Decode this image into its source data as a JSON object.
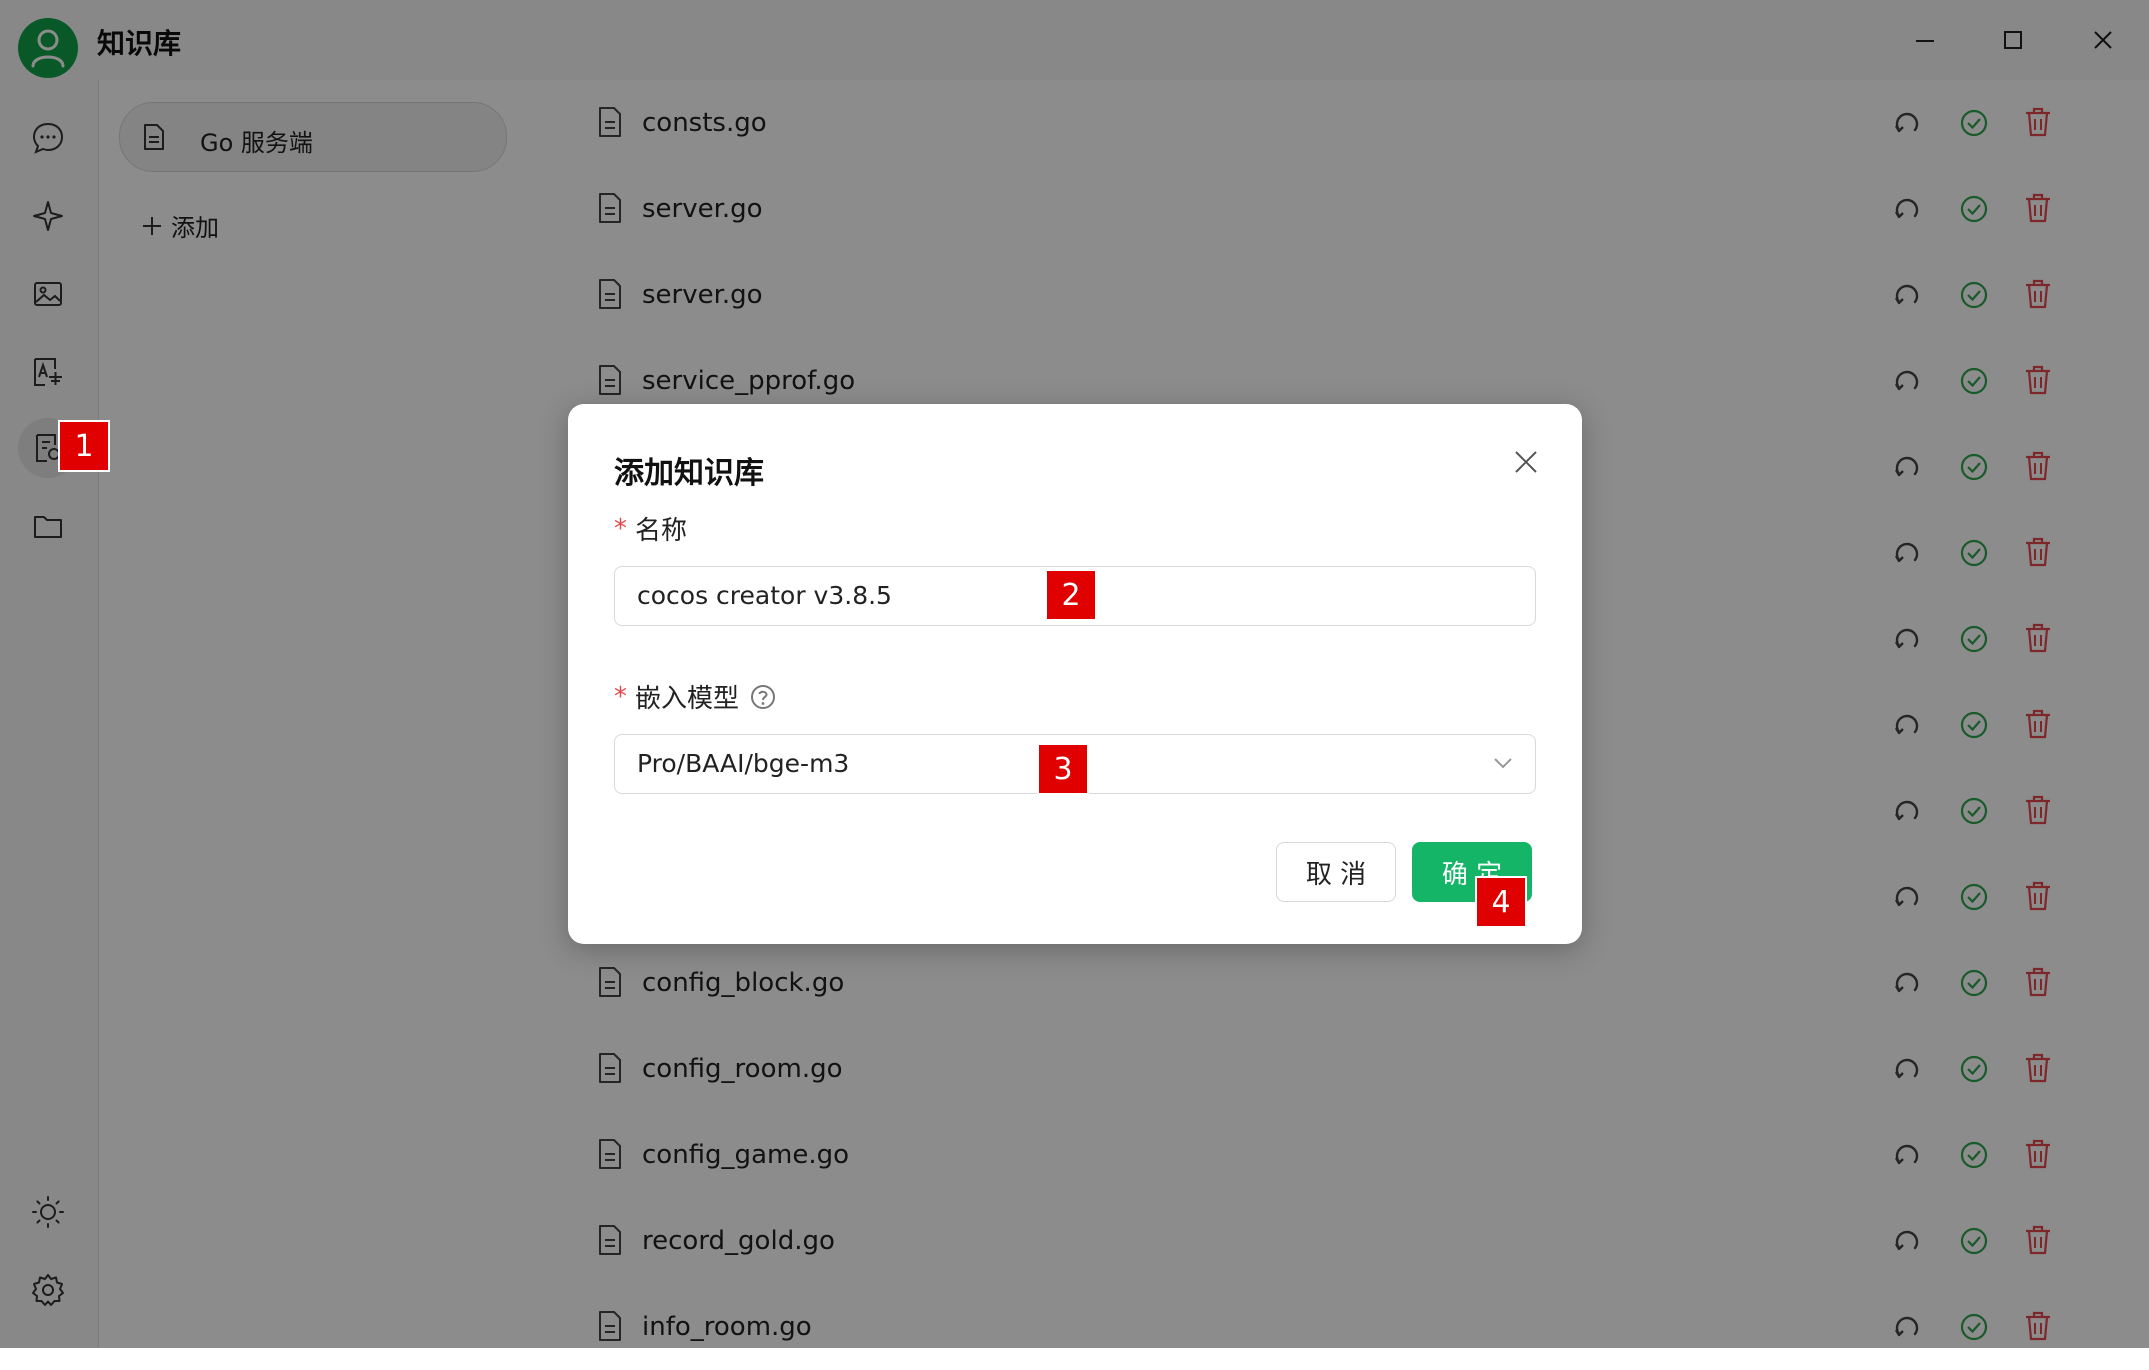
{
  "app": {
    "title": "知识库"
  },
  "window_controls": [
    "minimize-icon",
    "maximize-icon",
    "close-icon"
  ],
  "rail": {
    "items": [
      {
        "name": "chat",
        "icon": "chat-bubble-icon"
      },
      {
        "name": "assistant",
        "icon": "sparkle-icon"
      },
      {
        "name": "image",
        "icon": "image-icon"
      },
      {
        "name": "translate",
        "icon": "translate-icon"
      },
      {
        "name": "knowledge",
        "icon": "knowledge-book-icon",
        "active": true
      },
      {
        "name": "files",
        "icon": "folder-icon"
      }
    ],
    "bottom": [
      {
        "name": "theme",
        "icon": "sun-icon"
      },
      {
        "name": "settings",
        "icon": "gear-icon"
      }
    ]
  },
  "kb_panel": {
    "items": [
      {
        "label": "Go 服务端",
        "icon": "document-icon"
      }
    ],
    "add_label": "添加"
  },
  "files": [
    "consts.go",
    "server.go",
    "server.go",
    "service_pprof.go",
    "",
    "",
    "",
    "",
    "",
    "",
    "config_block.go",
    "config_room.go",
    "config_game.go",
    "record_gold.go",
    "info_room.go"
  ],
  "dialog": {
    "title": "添加知识库",
    "name_label": "名称",
    "name_value": "cocos creator v3.8.5",
    "model_label": "嵌入模型",
    "model_value": "Pro/BAAI/bge-m3",
    "cancel_label": "取 消",
    "ok_label": "确 定"
  },
  "markers": [
    "1",
    "2",
    "3",
    "4"
  ],
  "colors": {
    "accent": "#14b566",
    "danger": "#e5484d",
    "marker": "#e00000",
    "success": "#2da44e"
  }
}
